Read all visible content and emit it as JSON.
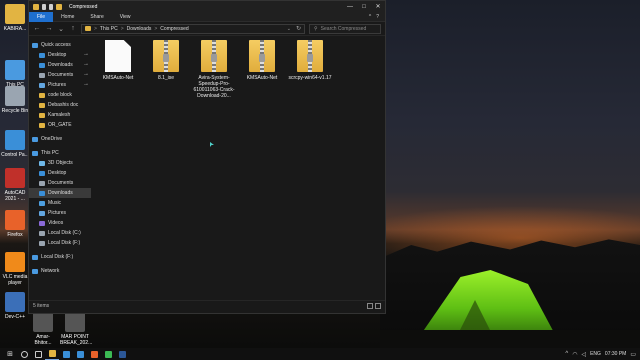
{
  "window": {
    "title": "Compressed",
    "ribbon_tabs": [
      "File",
      "Home",
      "Share",
      "View"
    ],
    "ribbon_right": [
      "^",
      "?"
    ],
    "controls": {
      "minimize": "—",
      "maximize": "□",
      "close": "✕"
    }
  },
  "address": {
    "crumbs": [
      "This PC",
      "Downloads",
      "Compressed"
    ],
    "separator": ">",
    "search_placeholder": "Search Compressed"
  },
  "navpane": {
    "quick_access": "Quick access",
    "pinned": [
      {
        "label": "Desktop",
        "icon": "desktop-icon",
        "color": "#3a8fd8"
      },
      {
        "label": "Downloads",
        "icon": "downloads-icon",
        "color": "#3a8fd8"
      },
      {
        "label": "Documents",
        "icon": "documents-icon",
        "color": "#9aa5b1"
      },
      {
        "label": "Pictures",
        "icon": "pictures-icon",
        "color": "#62a6e0"
      }
    ],
    "recent": [
      {
        "label": "code block",
        "icon": "folder-icon",
        "color": "#e2b442"
      },
      {
        "label": "Debashis doc",
        "icon": "folder-icon",
        "color": "#e2b442"
      },
      {
        "label": "Kamalesh",
        "icon": "folder-icon",
        "color": "#e2b442"
      },
      {
        "label": "OR_GATE",
        "icon": "folder-icon",
        "color": "#e2b442"
      }
    ],
    "onedrive": "OneDrive",
    "this_pc": "This PC",
    "pc_items": [
      {
        "label": "3D Objects",
        "icon": "3d-objects-icon",
        "color": "#6fb8e8"
      },
      {
        "label": "Desktop",
        "icon": "desktop-icon",
        "color": "#3a8fd8"
      },
      {
        "label": "Documents",
        "icon": "documents-icon",
        "color": "#9aa5b1"
      },
      {
        "label": "Downloads",
        "icon": "downloads-icon",
        "color": "#3a8fd8"
      },
      {
        "label": "Music",
        "icon": "music-icon",
        "color": "#4d9fe0"
      },
      {
        "label": "Pictures",
        "icon": "pictures-icon",
        "color": "#62a6e0"
      },
      {
        "label": "Videos",
        "icon": "videos-icon",
        "color": "#8a6ad8"
      },
      {
        "label": "Local Disk (C:)",
        "icon": "drive-icon",
        "color": "#9aa5b1"
      },
      {
        "label": "Local Disk (F:)",
        "icon": "drive-icon",
        "color": "#9aa5b1"
      }
    ],
    "external_drive": "Local Disk (F:)",
    "network": "Network"
  },
  "files": [
    {
      "name": "KMSAuto-Net",
      "kind": "doc"
    },
    {
      "name": "8.1_ise",
      "kind": "zip"
    },
    {
      "name": "Avira-System-Speedup-Pro-610011063-Crack-Download-20...",
      "kind": "zip"
    },
    {
      "name": "KMSAuto-Net",
      "kind": "zip"
    },
    {
      "name": "scrcpy-win64-v1.17",
      "kind": "zip"
    }
  ],
  "status": {
    "count": "5 items"
  },
  "desktop_icons": [
    {
      "label": "KABIRA...",
      "color": "#e2b442"
    },
    {
      "label": "This PC",
      "color": "#4a9ae0"
    },
    {
      "label": "Recycle Bin",
      "color": "#9aa5b1"
    },
    {
      "label": "Control Pa...",
      "color": "#3a8fd8"
    },
    {
      "label": "AutoCAD 2021 - ...",
      "color": "#c0302a"
    },
    {
      "label": "Firefox",
      "color": "#e8622a"
    },
    {
      "label": "VLC media player",
      "color": "#f08a1a"
    },
    {
      "label": "Dev-C++",
      "color": "#3b6fb8"
    },
    {
      "label": "Amar-Bhitor...",
      "color": "#555555"
    },
    {
      "label": "MAR POINT BREAK_202...",
      "color": "#555555"
    }
  ],
  "taskbar": {
    "start_icon": "windows-start-icon",
    "apps": [
      {
        "name": "search-icon",
        "color": "#cccccc"
      },
      {
        "name": "task-view-icon",
        "color": "#cccccc"
      },
      {
        "name": "file-explorer-icon",
        "color": "#e2b442"
      },
      {
        "name": "mail-icon",
        "color": "#3a8fd8"
      },
      {
        "name": "store-icon",
        "color": "#3a8fd8"
      },
      {
        "name": "firefox-icon",
        "color": "#e8622a"
      },
      {
        "name": "chrome-icon",
        "color": "#3cba54"
      },
      {
        "name": "word-icon",
        "color": "#2b5797"
      }
    ],
    "language": "ENG",
    "time": "07:30 PM"
  }
}
